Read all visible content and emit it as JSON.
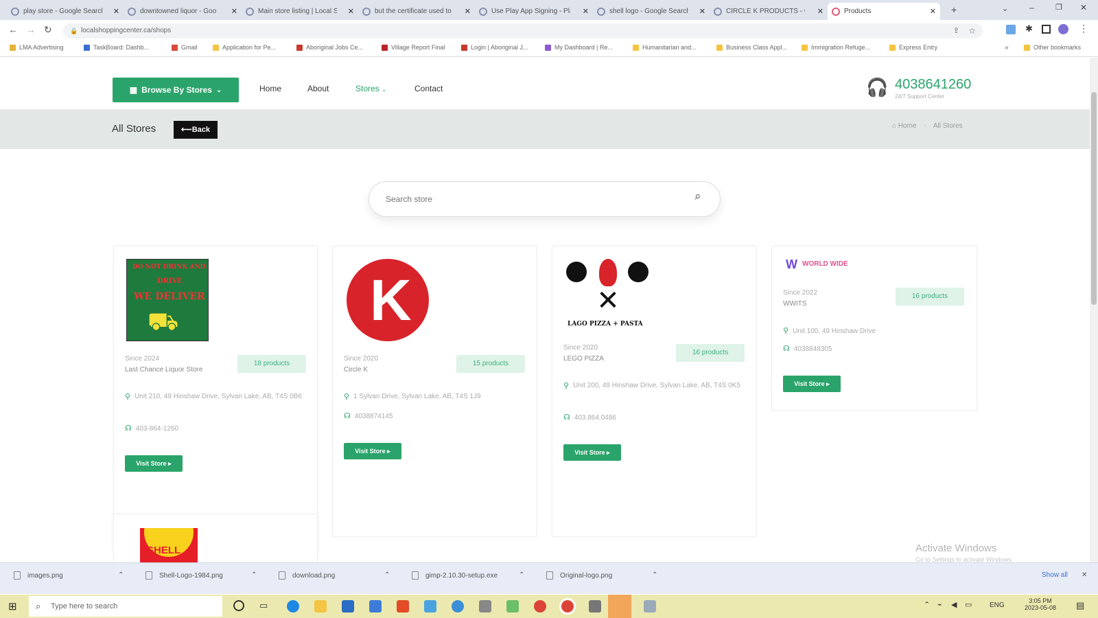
{
  "browser": {
    "tabs": [
      {
        "title": "play store - Google Search"
      },
      {
        "title": "downtowned liquor - Goo"
      },
      {
        "title": "Main store listing | Local S"
      },
      {
        "title": "but the certificate used to"
      },
      {
        "title": "Use Play App Signing - Pla"
      },
      {
        "title": "shell logo - Google Search"
      },
      {
        "title": "CIRCLE K PRODUCTS - Cir"
      },
      {
        "title": "Products"
      }
    ],
    "url": "localshoppingcenter.ca/shops",
    "bookmarks": [
      "LMA Advertising",
      "TaskBoard: Dashb...",
      "Gmail",
      "Application for Pe...",
      "Aboriginal Jobs Ce...",
      "Village Report Final",
      "Login | Aboriginal J...",
      "My Dashboard | Re...",
      "Humanitarian and...",
      "Business Class Appl...",
      "Immigration Refuge...",
      "Express Entry"
    ],
    "other_bookmarks": "Other bookmarks"
  },
  "site": {
    "browse_button": "Browse By Stores",
    "nav": [
      "Home",
      "About",
      "Stores",
      "Contact"
    ],
    "phone": "4038641260",
    "support": "24/7 Support Center",
    "page_title": "All Stores",
    "back_button": "Back",
    "breadcrumb": [
      "Home",
      "All Stores"
    ],
    "search_placeholder": "Search store",
    "stores": [
      {
        "since": "Since 2024",
        "name": "Last Chance Liquor Store",
        "products": "18 products",
        "address": "Unit 210, 49 Hinshaw Drive, Sylvan Lake, AB, T4S 0B6",
        "phone": "403-864-1260",
        "visit": "Visit Store",
        "logo_lines": [
          "DO NOT DRINK AND",
          "DRIVE",
          "WE DELIVER"
        ]
      },
      {
        "since": "Since 2020",
        "name": "Circle K",
        "products": "15 products",
        "address": "1 Sylvan Drive, Sylvan Lake, AB, T4S 1J9",
        "phone": "4038874145",
        "visit": "Visit Store"
      },
      {
        "since": "Since 2020",
        "name": "LEGO PIZZA",
        "products": "16 products",
        "address": "Unit 200, 49 Hinshaw Drive, Sylvan Lake, AB, T4S 0K5",
        "phone": "403.864.0486",
        "visit": "Visit Store",
        "logo_text": "LAGO PIZZA + PASTA"
      },
      {
        "since": "Since 2022",
        "name": "WWITS",
        "products": "16 products",
        "address": "Unit 100, 49 Hinshaw Drive",
        "phone": "4038848305",
        "visit": "Visit Store",
        "logo_text": "WORLD WIDE"
      }
    ],
    "watermark": "Activate Windows",
    "watermark_sub": "Go to Settings to activate Windows."
  },
  "downloads": {
    "items": [
      "images.png",
      "Shell-Logo-1984.png",
      "download.png",
      "gimp-2.10.30-setup.exe",
      "Original-logo.png"
    ],
    "show_all": "Show all"
  },
  "taskbar": {
    "search_placeholder": "Type here to search",
    "lang": "ENG",
    "time": "3:05 PM",
    "date": "2023-05-08"
  }
}
